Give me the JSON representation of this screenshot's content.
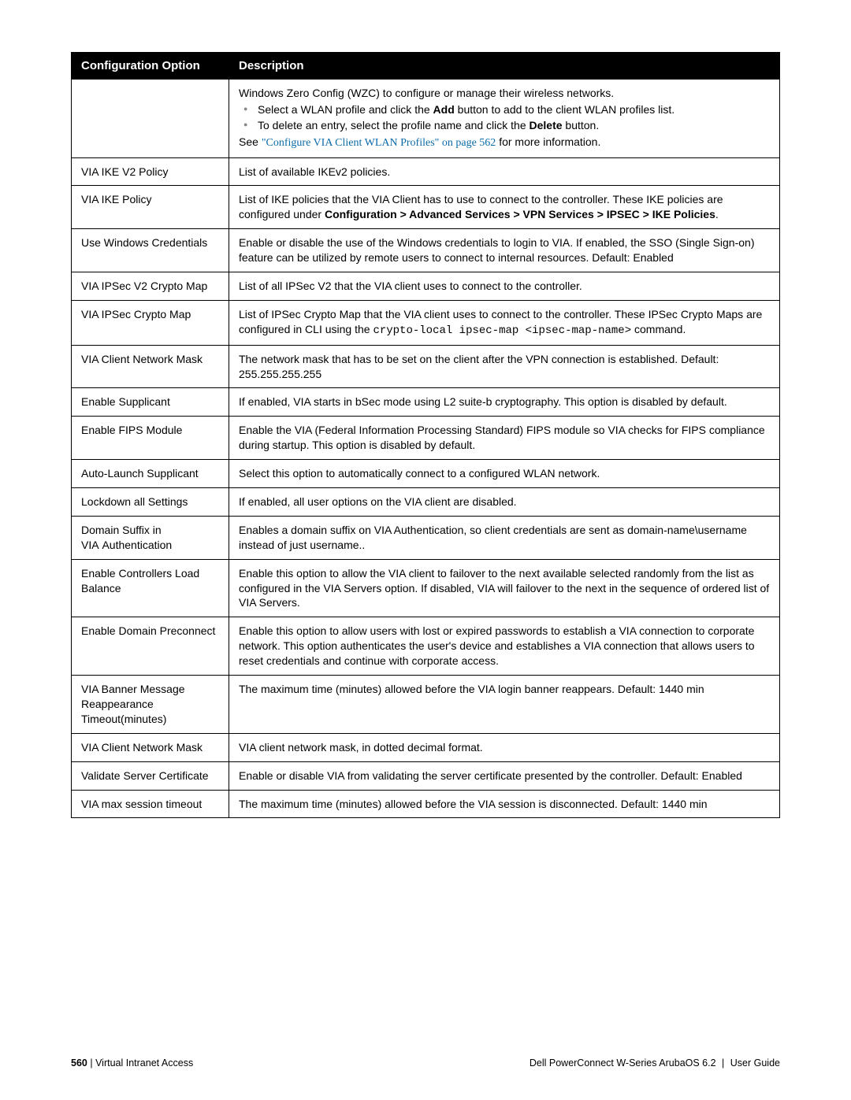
{
  "table": {
    "header_option": "Configuration Option",
    "header_description": "Description"
  },
  "row_first": {
    "intro": "Windows Zero Config (WZC) to configure or manage their wireless networks.",
    "b1_pre": "Select a WLAN profile and click the ",
    "b1_bold": "Add",
    "b1_post": " button to add to the client WLAN profiles list.",
    "b2_pre": "To delete an entry, select the profile name and click the ",
    "b2_bold": "Delete",
    "b2_post": " button.",
    "see_pre": "See ",
    "see_link": "\"Configure VIA Client WLAN Profiles\" on page 562",
    "see_post": " for more information."
  },
  "row_ikev2": {
    "opt": "VIA IKE V2 Policy",
    "desc": "List of available IKEv2 policies."
  },
  "row_ike": {
    "opt": "VIA IKE Policy",
    "pre": "List of IKE policies that the VIA Client has to use to connect to the controller. These IKE policies are configured under ",
    "bold": "Configuration > Advanced Services > VPN Services > IPSEC > IKE Policies",
    "post": "."
  },
  "row_wincred": {
    "opt": "Use Windows Credentials",
    "desc": "Enable or disable the use of the Windows credentials to login to VIA. If enabled, the SSO (Single Sign-on) feature can be utilized by remote users to connect to internal resources. Default: Enabled"
  },
  "row_ipsecv2": {
    "opt": "VIA IPSec V2 Crypto Map",
    "desc": "List of all IPSec V2 that the VIA client uses to connect to the controller."
  },
  "row_ipsec": {
    "opt": "VIA IPSec Crypto Map",
    "pre": "List of IPSec Crypto Map that the VIA client uses to connect to the controller. These IPSec Crypto Maps are configured in CLI using the ",
    "code": "crypto-local ipsec-map <ipsec-map-name>",
    "post": " command."
  },
  "row_netmask1": {
    "opt": "VIA Client Network Mask",
    "desc": "The network mask that has to be set on the client after the VPN connection is established. Default: 255.255.255.255"
  },
  "row_supp": {
    "opt": "Enable Supplicant",
    "desc": "If enabled, VIA starts in bSec mode using L2 suite-b cryptography. This option is disabled by default."
  },
  "row_fips": {
    "opt": "Enable FIPS Module",
    "desc": "Enable the VIA (Federal Information Processing Standard) FIPS module so VIA checks for FIPS compliance during startup. This option is disabled by default."
  },
  "row_autosupp": {
    "opt": "Auto-Launch Supplicant",
    "desc": "Select this option to automatically connect to a configured WLAN network."
  },
  "row_lockdown": {
    "opt": "Lockdown all Settings",
    "desc": "If enabled, all user options on the VIA client are disabled."
  },
  "row_domain": {
    "opt": "Domain Suffix in VIA Authentication",
    "desc": "Enables a domain suffix on VIA Authentication, so client credentials are sent as domain-name\\username instead of just username.."
  },
  "row_loadbal": {
    "opt": "Enable Controllers Load Balance",
    "desc": "Enable this option to allow the VIA client to failover to the next available selected randomly from the list as configured in the VIA Servers option. If disabled, VIA will failover to the next in the sequence of ordered list of VIA Servers."
  },
  "row_preconn": {
    "opt": "Enable Domain Preconnect",
    "desc": "Enable this option to allow users with lost or expired passwords to establish a VIA connection to corporate network. This option authenticates the user's device and establishes a VIA connection that allows users to reset credentials and continue with corporate access."
  },
  "row_banner": {
    "opt": "VIA Banner Message Reappearance Timeout(minutes)",
    "desc": "The maximum time (minutes) allowed before the VIA login banner reappears. Default: 1440 min"
  },
  "row_netmask2": {
    "opt": "VIA Client Network Mask",
    "desc": "VIA client network mask, in dotted decimal format."
  },
  "row_validate": {
    "opt": "Validate Server Certificate",
    "desc": "Enable or disable VIA from validating the server certificate presented by the controller. Default: Enabled"
  },
  "row_maxsess": {
    "opt": "VIA max session timeout",
    "desc": "The maximum time (minutes) allowed before the VIA session is disconnected. Default: 1440 min"
  },
  "footer": {
    "page": "560",
    "sep1": " | ",
    "section": "Virtual Intranet Access",
    "product": "Dell PowerConnect W-Series ArubaOS 6.2",
    "sep2": "  |  ",
    "doc": "User Guide"
  }
}
